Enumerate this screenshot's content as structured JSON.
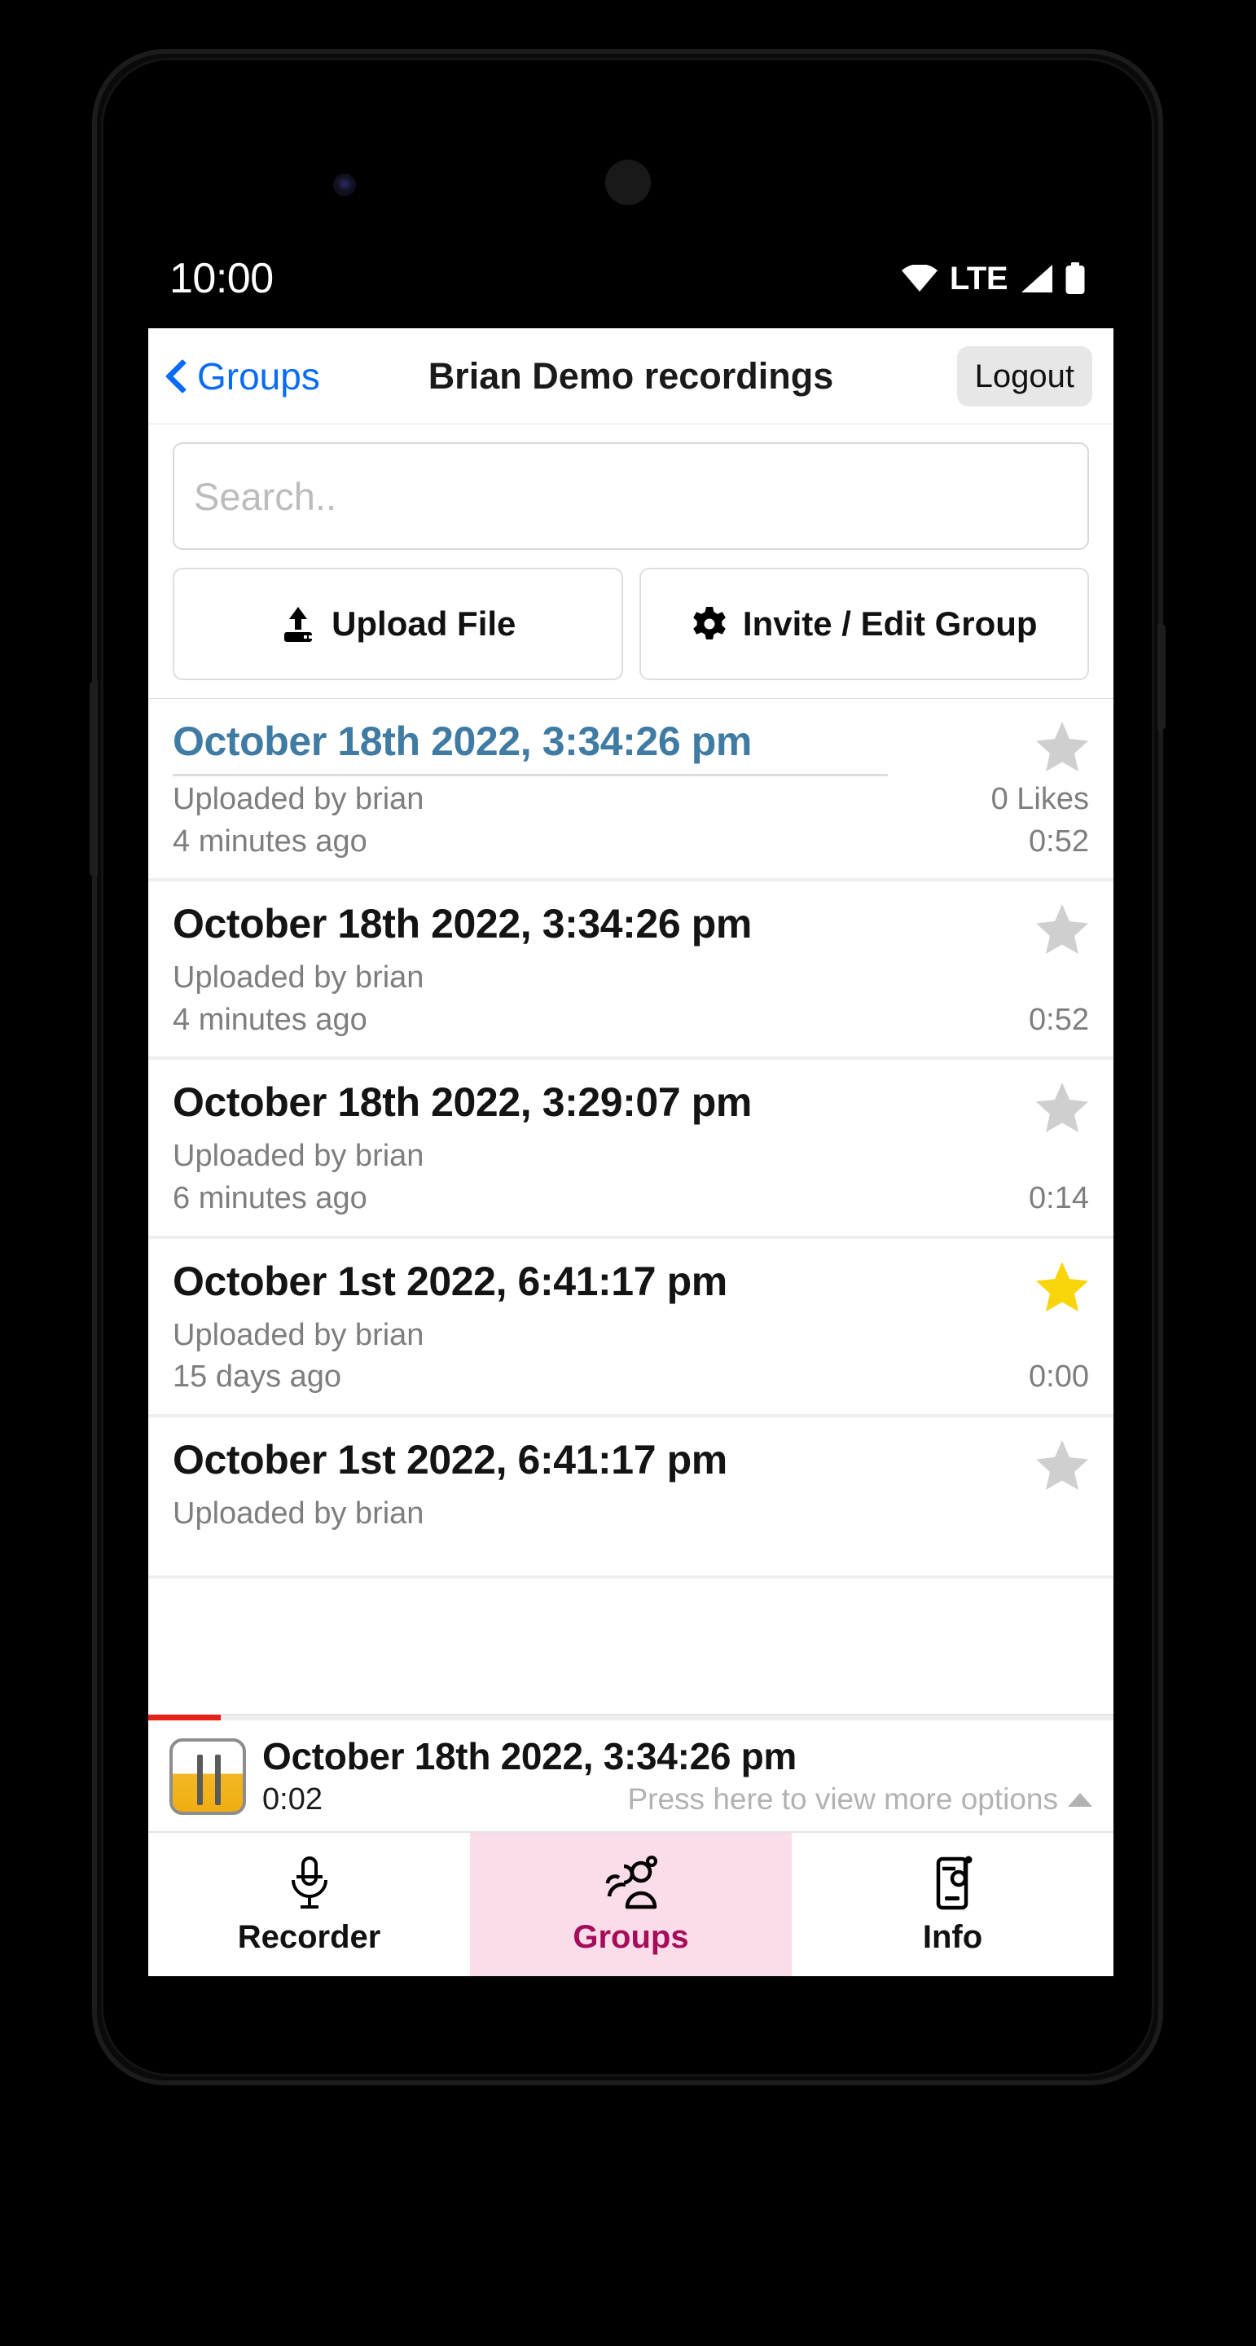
{
  "status_bar": {
    "time": "10:00",
    "icons": [
      "wifi-icon",
      "lte-label",
      "cellular-signal-icon",
      "battery-icon"
    ],
    "network_label": "LTE"
  },
  "navbar": {
    "back_label": "Groups",
    "title": "Brian Demo recordings",
    "logout_label": "Logout"
  },
  "toolbar": {
    "search_placeholder": "Search..",
    "search_value": "",
    "upload_label": "Upload File",
    "invite_label": "Invite / Edit Group"
  },
  "recordings": [
    {
      "title": "October 18th 2022, 3:34:26 pm",
      "uploader": "Uploaded by brian",
      "relative_time": "4 minutes ago",
      "likes": "0 Likes",
      "duration": "0:52",
      "starred": false,
      "selected": true
    },
    {
      "title": "October 18th 2022, 3:34:26 pm",
      "uploader": "Uploaded by brian",
      "relative_time": "4 minutes ago",
      "likes": "",
      "duration": "0:52",
      "starred": false,
      "selected": false
    },
    {
      "title": "October 18th 2022, 3:29:07 pm",
      "uploader": "Uploaded by brian",
      "relative_time": "6 minutes ago",
      "likes": "",
      "duration": "0:14",
      "starred": false,
      "selected": false
    },
    {
      "title": "October 1st 2022, 6:41:17 pm",
      "uploader": "Uploaded by brian",
      "relative_time": "15 days ago",
      "likes": "",
      "duration": "0:00",
      "starred": true,
      "selected": false
    },
    {
      "title": "October 1st 2022, 6:41:17 pm",
      "uploader": "Uploaded by brian",
      "relative_time": "",
      "likes": "",
      "duration": "",
      "starred": false,
      "selected": false
    }
  ],
  "player": {
    "title": "October 18th 2022, 3:34:26 pm",
    "elapsed": "0:02",
    "hint": "Press here to view more options",
    "state": "playing",
    "progress_percent": 7
  },
  "tabs": [
    {
      "label": "Recorder",
      "icon": "microphone-icon",
      "active": false
    },
    {
      "label": "Groups",
      "icon": "people-group-icon",
      "active": true
    },
    {
      "label": "Info",
      "icon": "phone-info-icon",
      "active": false
    }
  ],
  "colors": {
    "accent_blue": "#0a6cf5",
    "selected_title": "#3f7ba3",
    "star_filled": "#f9d408",
    "star_empty": "#cfcfcf",
    "tab_active_bg": "#fbdde9",
    "tab_active_text": "#a50d5b",
    "progress_red": "#e8201a",
    "player_accent": "#f0ad12"
  }
}
